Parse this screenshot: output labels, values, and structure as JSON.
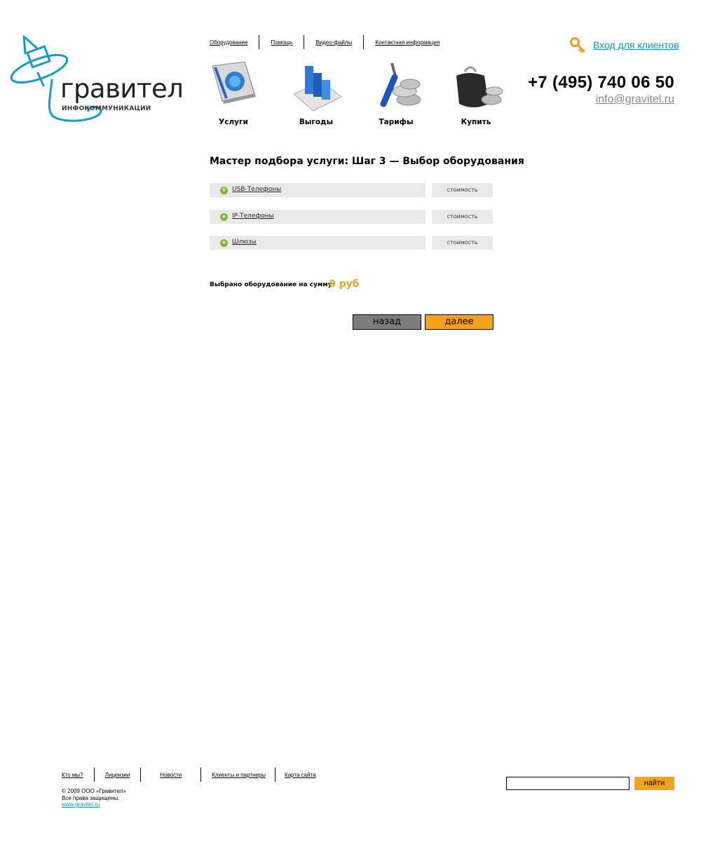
{
  "brand": {
    "name": "гравител",
    "subtitle": "ИНФОКОММУНИКАЦИИ"
  },
  "topnav": [
    "Оборудование",
    "Помощь",
    "Видео-файлы",
    "Контактная информация"
  ],
  "login": {
    "label": "Вход для клиентов"
  },
  "contact": {
    "phone": "+7 (495) 740 06 50",
    "email": "info@gravitel.ru"
  },
  "bignav": [
    {
      "label": "Услуги",
      "icon": "book-globe-icon"
    },
    {
      "label": "Выгоды",
      "icon": "bar-chart-icon"
    },
    {
      "label": "Тарифы",
      "icon": "screwdriver-coins-icon"
    },
    {
      "label": "Купить",
      "icon": "wallet-icon"
    }
  ],
  "page_title": "Мастер подбора услуги: Шаг 3 — Выбор оборудования",
  "equipment": [
    {
      "name": "USB-Телефоны",
      "cost_label": "стоимость"
    },
    {
      "name": "IP-Телефоны",
      "cost_label": "стоимость"
    },
    {
      "name": "Шлюзы",
      "cost_label": "стоимость"
    }
  ],
  "summary": {
    "label": "Выбрано оборудование на сумму:",
    "value": "0 руб"
  },
  "buttons": {
    "back": "назад",
    "next": "далее"
  },
  "footer": {
    "nav": [
      "Кто мы?",
      "Лицензии",
      "Новости",
      "Клиенты и партнеры",
      "Карта сайта"
    ],
    "copyright_line1": "© 2009 ООО «Гравител»",
    "copyright_line2": "Все права защищены.",
    "site": "www.gravitel.ru",
    "search_button": "найти",
    "search_value": ""
  },
  "colors": {
    "accent": "#f7a21b",
    "link": "#1a8fb8",
    "logo": "#1a9ac4",
    "row_bg": "#e9e9e9",
    "plus": "#7cb82f",
    "sum": "#f0a11e"
  }
}
